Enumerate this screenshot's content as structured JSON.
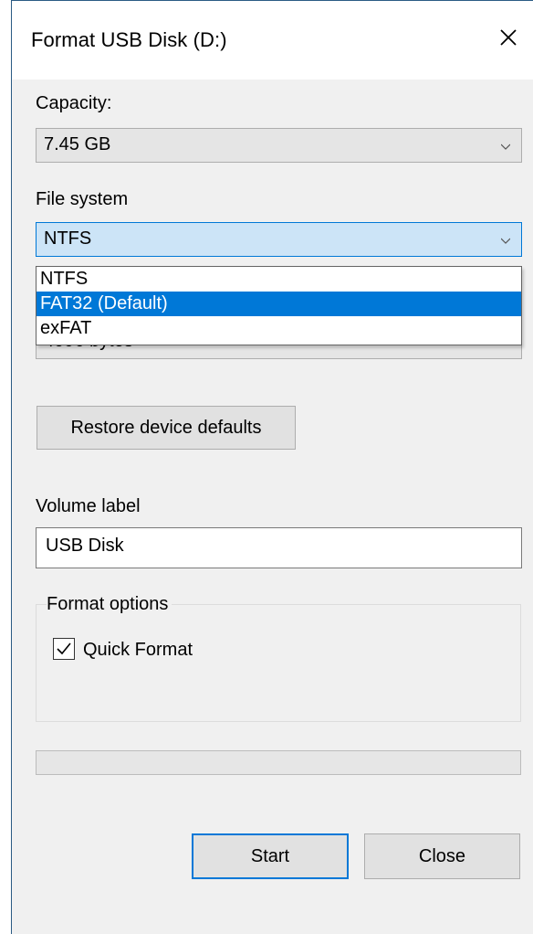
{
  "window": {
    "title": "Format USB Disk (D:)",
    "close_icon": "close-x-icon"
  },
  "capacity": {
    "label": "Capacity:",
    "value": "7.45 GB"
  },
  "file_system": {
    "label": "File system",
    "value": "NTFS",
    "options": [
      {
        "label": "NTFS",
        "selected": false
      },
      {
        "label": "FAT32 (Default)",
        "selected": true
      },
      {
        "label": "exFAT",
        "selected": false
      }
    ]
  },
  "allocation": {
    "value": "4096 bytes"
  },
  "restore_button": {
    "label": "Restore device defaults"
  },
  "volume": {
    "label": "Volume label",
    "value": "USB Disk"
  },
  "format_options": {
    "legend": "Format options",
    "quick_format_label": "Quick Format",
    "quick_format_checked": true
  },
  "progress": {
    "value": 0
  },
  "buttons": {
    "start": "Start",
    "close": "Close"
  },
  "colors": {
    "accent": "#0078d7",
    "dialog_bg": "#f0f0f0",
    "open_combo_bg": "#cce4f7"
  }
}
